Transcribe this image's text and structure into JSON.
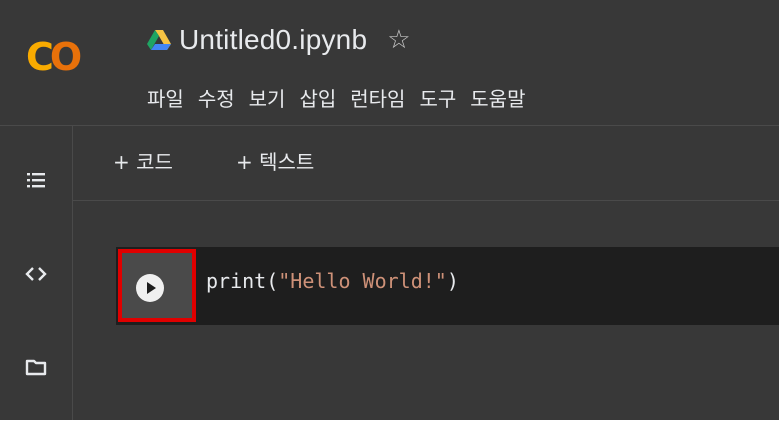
{
  "header": {
    "logo_text_c": "C",
    "logo_text_o": "O",
    "notebook_title": "Untitled0.ipynb",
    "star_icon": "☆"
  },
  "menu": {
    "items": [
      {
        "label": "파일"
      },
      {
        "label": "수정"
      },
      {
        "label": "보기"
      },
      {
        "label": "삽입"
      },
      {
        "label": "런타임"
      },
      {
        "label": "도구"
      },
      {
        "label": "도움말"
      }
    ]
  },
  "toolbar": {
    "add_code_label": "+ 코드",
    "add_text_label": "+ 텍스트"
  },
  "sidebar": {
    "icons": [
      "toc-icon",
      "code-snippets-icon",
      "folder-icon"
    ]
  },
  "cell": {
    "code_prefix": "print(",
    "code_string": "\"Hello World!\"",
    "code_suffix": ")"
  },
  "colors": {
    "background": "#383838",
    "cell_background": "#1e1e1e",
    "highlight_border": "#e00000",
    "logo_yellow": "#f9ab00",
    "logo_orange": "#e8710a",
    "string_color": "#ce9178"
  }
}
